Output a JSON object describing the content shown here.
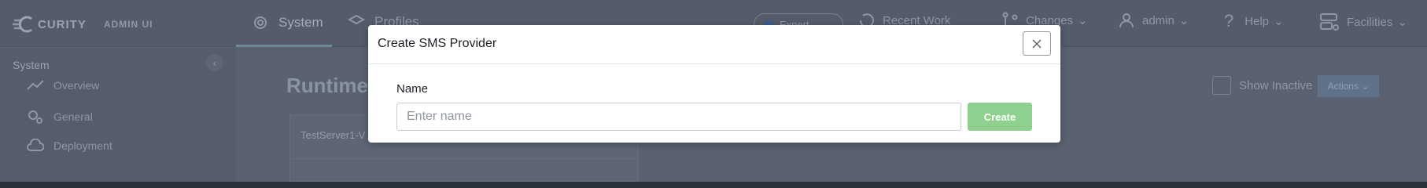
{
  "app": {
    "brand": "CURITY",
    "subtitle": "ADMIN UI"
  },
  "header": {
    "tabs": [
      {
        "label": "System",
        "active": true
      },
      {
        "label": "Profiles",
        "active": false
      }
    ],
    "mode_toggle": "Expert",
    "recent_work": "Recent Work",
    "changes": "Changes",
    "user": "admin",
    "help": "Help",
    "facilities": "Facilities"
  },
  "sidebar": {
    "title": "System",
    "items": [
      {
        "label": "Overview",
        "icon": "trend-icon"
      },
      {
        "label": "General",
        "icon": "gears-icon"
      },
      {
        "label": "Deployment",
        "icon": "cloud-upload-icon"
      }
    ]
  },
  "main": {
    "title": "Runtime",
    "server_name": "TestServer1-V",
    "show_inactive": "Show Inactive",
    "actions": "Actions"
  },
  "modal": {
    "title": "Create SMS Provider",
    "field_label": "Name",
    "input_value": "",
    "input_placeholder": "Enter name",
    "create_label": "Create",
    "colors": {
      "create_button": "#8fd08f",
      "overlay": "#2a303c"
    }
  }
}
